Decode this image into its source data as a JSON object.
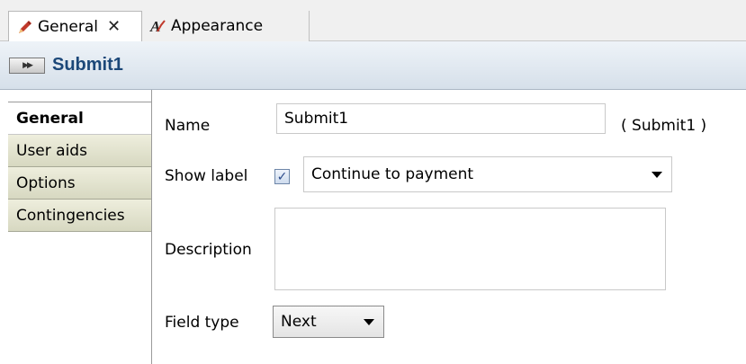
{
  "tabs": [
    {
      "label": "General",
      "icon": "pencil-icon",
      "active": true
    },
    {
      "label": "Appearance",
      "icon": "font-style-icon",
      "active": false
    }
  ],
  "close_glyph": "✕",
  "header": {
    "icon": "submit-button-icon",
    "title": "Submit1"
  },
  "nav": {
    "items": [
      {
        "label": "General",
        "active": true
      },
      {
        "label": "User aids"
      },
      {
        "label": "Options"
      },
      {
        "label": "Contingencies"
      }
    ]
  },
  "form": {
    "name_label": "Name",
    "name_value": "Submit1",
    "name_paren": "( Submit1 )",
    "show_label": "Show label",
    "show_label_checked": true,
    "show_label_value": "Continue to payment",
    "description_label": "Description",
    "description_value": "",
    "field_type_label": "Field type",
    "field_type_value": "Next"
  },
  "colors": {
    "header_title": "#1b4778",
    "nav_bg": "#dedfc9",
    "checkbox": "#2b4a8b"
  }
}
